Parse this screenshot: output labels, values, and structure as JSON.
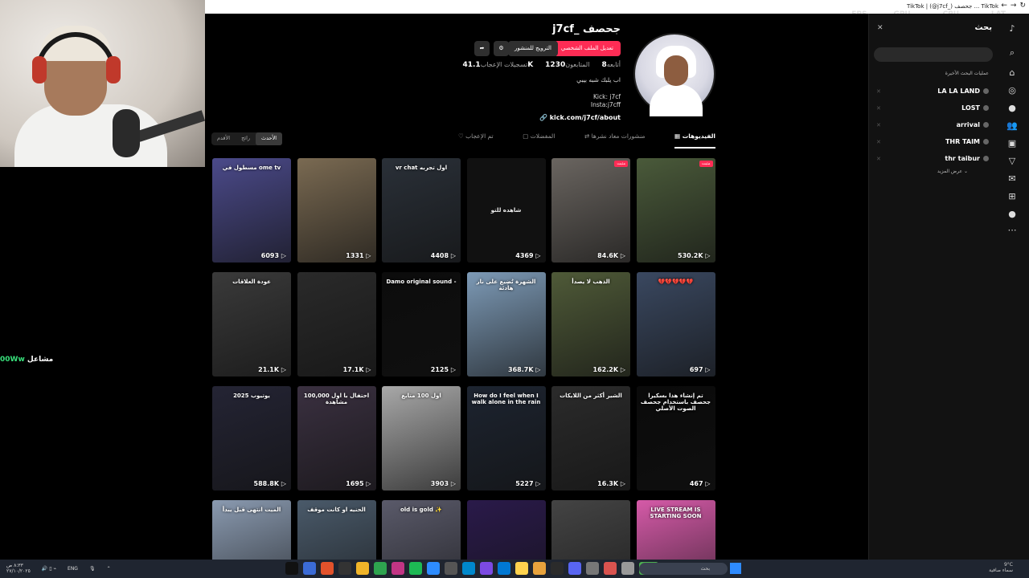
{
  "browser": {
    "tab_title": "TikTok | (@j7cf_) جحصف ... TikTok"
  },
  "overlay": {
    "fps_label": "FPS",
    "fps_value": "N/A",
    "gpu_label": "GPU",
    "gpu_value": "27 %",
    "cpu_label": "CPU",
    "cpu_value": "45 %",
    "lat_label": "LAT",
    "lat_value": "N/A"
  },
  "stream_chat": {
    "user": "00Ww",
    "label": "مشاعل"
  },
  "profile": {
    "name": "j7cf_ جحصف",
    "edit_button": "تعديل الملف الشخصي",
    "promote_button": "الترويج للمنشور",
    "stats": [
      {
        "value": "8",
        "label": "أتابعه"
      },
      {
        "value": "1230",
        "label": "المتابعون"
      },
      {
        "value": "41.1K",
        "label": "تسجيلات الإعجاب"
      }
    ],
    "bio_line1": "اب يلبك شبه بيبي",
    "bio_line2": "Kick: j7cf",
    "bio_line3": "Insta:j7cff",
    "link": "kick.com/j7cf/about"
  },
  "tabs": {
    "videos": "الفيديوهات",
    "reposts": "منشورات معاد نشرها",
    "favorites": "المفضلات",
    "liked": "تم الإعجاب"
  },
  "sort": {
    "latest": "الأحدث",
    "popular": "رائج",
    "oldest": "الأقدم"
  },
  "videos": [
    {
      "count": "530.2K",
      "caption": "",
      "color": "#4a5a3a",
      "badge": "مثبت"
    },
    {
      "count": "84.6K",
      "caption": "",
      "color": "#6a6560",
      "badge": "مثبت"
    },
    {
      "count": "4369",
      "caption": "شاهده للتو",
      "color": "#111111",
      "badge": ""
    },
    {
      "count": "4408",
      "caption": "vr chat اول تجربه",
      "color": "#2a3038",
      "badge": ""
    },
    {
      "count": "1331",
      "caption": "",
      "color": "#7a6a52",
      "badge": ""
    },
    {
      "count": "6093",
      "caption": "مسطول في ome tv",
      "color": "#4b4a8a",
      "badge": ""
    },
    {
      "count": "697",
      "caption": "💔💔💔💔💔",
      "color": "#3a4860",
      "badge": ""
    },
    {
      "count": "162.2K",
      "caption": "الذهب لا يصدأ",
      "color": "#4f5a38",
      "badge": ""
    },
    {
      "count": "368.7K",
      "caption": "الشهرة تُضِيع على نار هادئة",
      "color": "#7d9ab6",
      "badge": ""
    },
    {
      "count": "2125",
      "caption": "Damo original sound -",
      "color": "#0c0c0c",
      "badge": ""
    },
    {
      "count": "17.1K",
      "caption": "",
      "color": "#2a2a2a",
      "badge": ""
    },
    {
      "count": "21.1K",
      "caption": "عودة العلاقات",
      "color": "#3a3a3a",
      "badge": ""
    },
    {
      "count": "467",
      "caption": "تم إنشاء هذا بسكيرا جحصف باستخدام جحصف الصوت الأصلي",
      "color": "#0a0a0a",
      "badge": ""
    },
    {
      "count": "16.3K",
      "caption": "الشير أكثر من اللايكات",
      "color": "#2b2b2b",
      "badge": ""
    },
    {
      "count": "5227",
      "caption": "How do I feel when I walk alone in the rain",
      "color": "#1d2430",
      "badge": ""
    },
    {
      "count": "3903",
      "caption": "اول 100 متابع",
      "color": "#a8a8a8",
      "badge": ""
    },
    {
      "count": "1695",
      "caption": "احتفال با اول 100,000 مشاهدة",
      "color": "#3a3040",
      "badge": ""
    },
    {
      "count": "588.8K",
      "caption": "2025 يوتيوب",
      "color": "#242434",
      "badge": ""
    },
    {
      "count": "",
      "caption": "LIVE STREAM IS STARTING SOON",
      "color": "#d55aa8",
      "badge": ""
    },
    {
      "count": "",
      "caption": "",
      "color": "#444444",
      "badge": ""
    },
    {
      "count": "",
      "caption": "",
      "color": "#2a1a4a",
      "badge": ""
    },
    {
      "count": "",
      "caption": "old is gold ✨",
      "color": "#5a5a6a",
      "badge": ""
    },
    {
      "count": "",
      "caption": "الحنيه او كانت موقف",
      "color": "#4a5a6a",
      "badge": ""
    },
    {
      "count": "",
      "caption": "الميت انتهى قبل يبدأ",
      "color": "#8a9ab0",
      "badge": ""
    }
  ],
  "search_panel": {
    "title": "بحث",
    "recent_heading": "عمليات البحث الأخيرة",
    "recent": [
      "LA LA LAND",
      "LOST",
      "arrival",
      "THR TAIM",
      "thr taibur"
    ],
    "more": "عرض المزيد"
  },
  "taskbar": {
    "lang": "ENG",
    "search_placeholder": "بحث",
    "weather": "9°C",
    "weather_desc": "سماء صافية",
    "time": "٨:٣٣ ص",
    "date": "٢٧/١٠/٢٠٢٥"
  }
}
